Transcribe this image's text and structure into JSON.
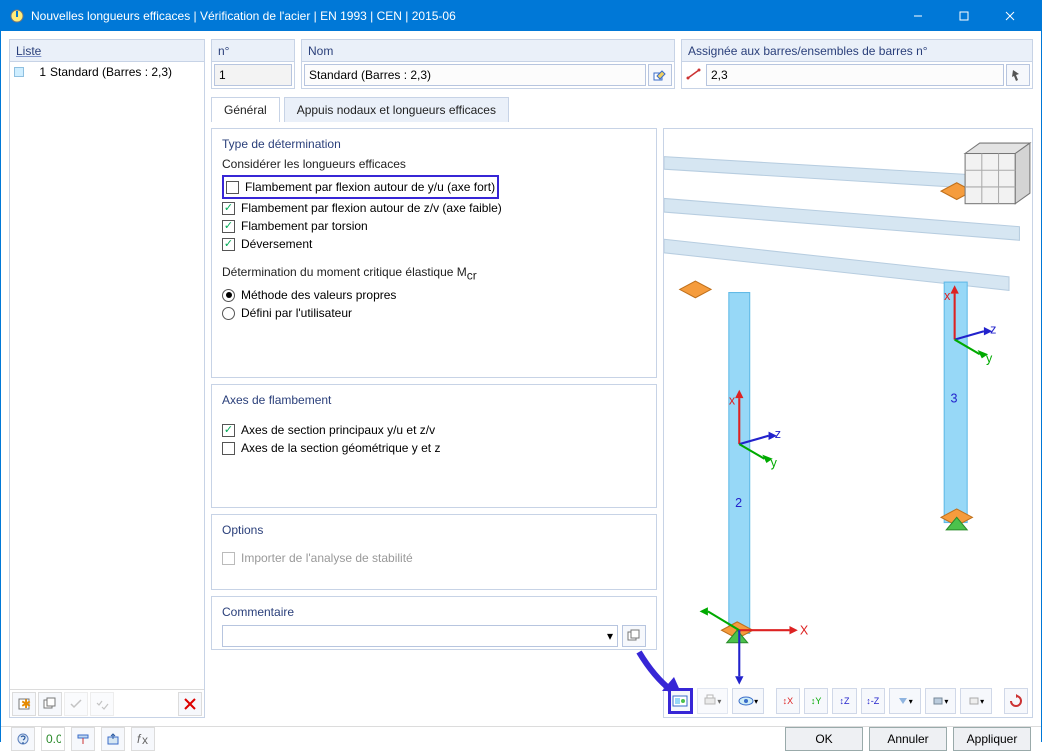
{
  "title": "Nouvelles longueurs efficaces | Vérification de l'acier | EN 1993 | CEN | 2015-06",
  "left_panel": {
    "header": "Liste",
    "items": [
      {
        "index": "1",
        "label": "Standard (Barres : 2,3)"
      }
    ]
  },
  "fields": {
    "num_label": "n°",
    "num_value": "1",
    "nom_label": "Nom",
    "nom_value": "Standard (Barres : 2,3)",
    "assign_label": "Assignée aux barres/ensembles de barres n°",
    "assign_value": "2,3"
  },
  "tabs": {
    "general": "Général",
    "supports": "Appuis nodaux et longueurs efficaces"
  },
  "group_type": {
    "title": "Type de détermination",
    "subtitle_lengths": "Considérer les longueurs efficaces",
    "chk_flex_y": "Flambement par flexion autour de y/u (axe fort)",
    "chk_flex_z": "Flambement par flexion autour de z/v (axe faible)",
    "chk_torsion": "Flambement par torsion",
    "chk_deversement": "Déversement",
    "subtitle_mcr": "Détermination du moment critique élastique M",
    "subtitle_mcr_sub": "cr",
    "rad_eigen": "Méthode des valeurs propres",
    "rad_user": "Défini par l'utilisateur"
  },
  "group_axes": {
    "title": "Axes de flambement",
    "chk_principal": "Axes de section principaux y/u et z/v",
    "chk_geometric": "Axes de la section géométrique y et z"
  },
  "group_opts": {
    "title": "Options",
    "chk_import": "Importer de l'analyse de stabilité"
  },
  "group_comment": {
    "title": "Commentaire"
  },
  "preview_labels": {
    "axis_x": "x",
    "axis_y": "y",
    "axis_z": "z",
    "member2": "2",
    "member3": "3"
  },
  "buttons": {
    "ok": "OK",
    "cancel": "Annuler",
    "apply": "Appliquer"
  }
}
